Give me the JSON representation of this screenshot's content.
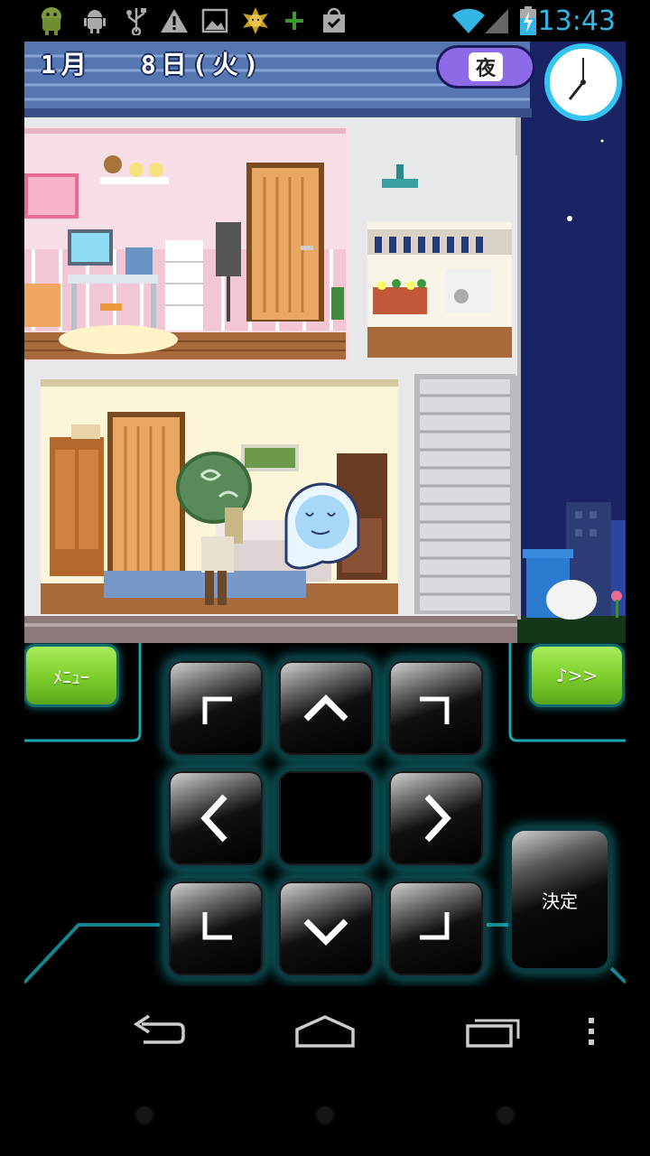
{
  "status_bar": {
    "time": "13:43",
    "icons": [
      "android-robot-icon",
      "android-debug-icon",
      "usb-icon",
      "warning-icon",
      "image-icon",
      "sun-badge-icon",
      "plus-icon",
      "shopping-bag-check-icon",
      "wifi-icon",
      "signal-icon",
      "battery-charging-icon"
    ],
    "accent_color": "#33b5e5"
  },
  "game": {
    "date_month": "1月",
    "date_day": "8日(火)",
    "time_of_day": "夜",
    "characters": [
      "afro-character",
      "ghost-character"
    ]
  },
  "controller": {
    "menu_label": "ﾒﾆｭｰ",
    "music_label": "♪>>",
    "ok_label": "決定",
    "dpad": [
      "up-left",
      "up",
      "up-right",
      "left",
      "center",
      "right",
      "down-left",
      "down",
      "down-right"
    ],
    "glow_color": "#1ec8d2"
  },
  "nav_bar": {
    "buttons": [
      "back-icon",
      "home-icon",
      "recent-apps-icon",
      "overflow-menu-icon"
    ]
  }
}
